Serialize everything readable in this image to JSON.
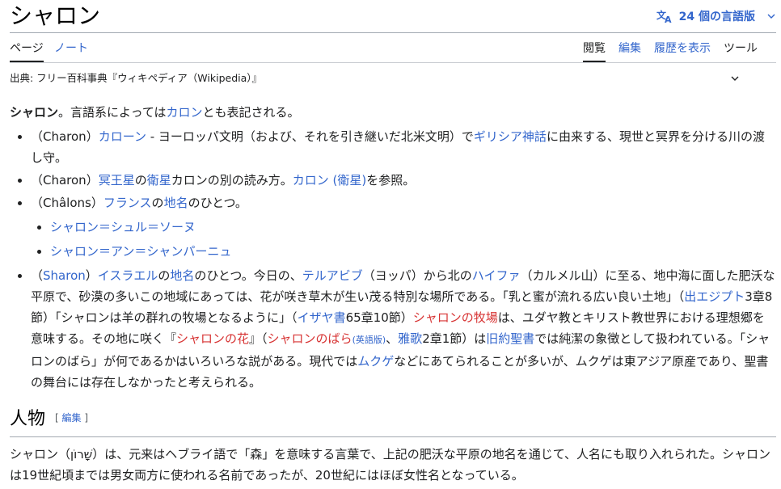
{
  "header": {
    "title": "シャロン",
    "language_button": "24 個の言語版",
    "language_icon": "translate-icon",
    "chevron_icon": "chevron-down-icon"
  },
  "tabs": {
    "left": [
      "ページ",
      "ノート"
    ],
    "right": [
      "閲覧",
      "編集",
      "履歴を表示",
      "ツール"
    ]
  },
  "site_sub": "出典: フリー百科事典『ウィキペディア（Wikipedia）』",
  "intro": {
    "bold": "シャロン",
    "t1": "。言語系によっては",
    "link": "カロン",
    "t2": "とも表記される。"
  },
  "items": {
    "i1": {
      "prefix": "（Charon）",
      "link1": "カローン",
      "t1": " - ヨーロッパ文明（および、それを引き継いだ北米文明）で",
      "link2": "ギリシア神話",
      "t2": "に由来する、現世と冥界を分ける川の渡し守。"
    },
    "i2": {
      "prefix": "（Charon）",
      "link1": "冥王星",
      "t1": "の",
      "link2": "衛星",
      "t2": "カロンの別の読み方。",
      "link3": "カロン (衛星)",
      "t3": "を参照。"
    },
    "i3": {
      "prefix": "（Châlons）",
      "link1": "フランス",
      "t1": "の",
      "link2": "地名",
      "t2": "のひとつ。",
      "sub": [
        "シャロン＝シュル＝ソーヌ",
        "シャロン＝アン＝シャンパーニュ"
      ]
    },
    "i4": {
      "p_open": "（",
      "sharon": "Sharon",
      "p_close": "）",
      "l_israel": "イスラエル",
      "t1": "の",
      "l_chimei": "地名",
      "t2": "のひとつ。今日の、",
      "l_telaviv": "テルアビブ",
      "t3": "（ヨッパ）から北の",
      "l_haifa": "ハイファ",
      "t4": "（カルメル山）に至る、地中海に面した肥沃な平原で、砂漠の多いこの地域にあっては、花が咲き草木が生い茂る特別な場所である。「乳と蜜が流れる広い良い土地」（",
      "l_exodus": "出エジプト",
      "t5": "3章8節）「シャロンは羊の群れの牧場となるように」（",
      "l_isaiah": "イザヤ書",
      "t6": "65章10節）",
      "l_pasture": "シャロンの牧場",
      "t7": "は、ユダヤ教とキリスト教世界における理想郷を意味する。その地に咲く『",
      "l_flower": "シャロンの花",
      "t8": "』（",
      "l_rose": "シャロンのばら",
      "l_en": "(英語版)",
      "t9": "、",
      "l_song": "雅歌",
      "t10": "2章1節）は",
      "l_ot": "旧約聖書",
      "t11": "では純潔の象徴として扱われている。「シャロンのばら」が何であるかはいろいろな説がある。現代では",
      "l_mukuge": "ムクゲ",
      "t12": "などにあてられることが多いが、ムクゲは東アジア原産であり、聖書の舞台には存在しなかったと考えられる。"
    }
  },
  "section": {
    "heading": "人物",
    "edit_open": "[ ",
    "edit_label": "編集",
    "edit_close": " ]",
    "paragraph": "シャロン（שָׁרוֹן）は、元来はヘブライ語で「森」を意味する言葉で、上記の肥沃な平原の地名を通じて、人名にも取り入れられた。シャロンは19世紀頃までは男女両方に使われる名前であったが、20世紀にはほぼ女性名となっている。"
  },
  "colors": {
    "link": "#3366cc",
    "redlink": "#d73333",
    "text": "#202122"
  }
}
